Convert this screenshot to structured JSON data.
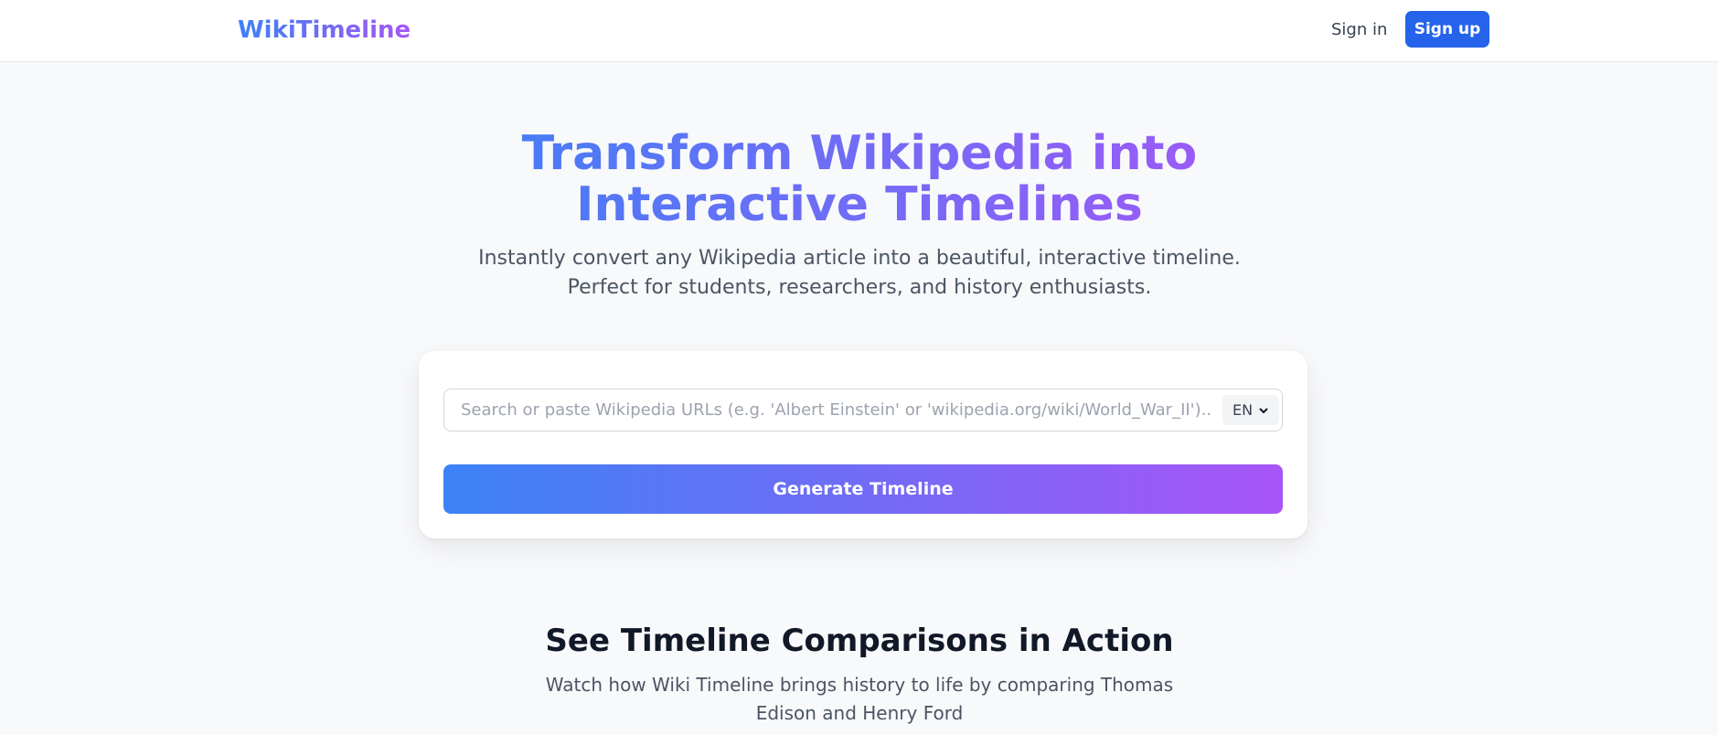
{
  "nav": {
    "brand": "WikiTimeline",
    "signin_label": "Sign in",
    "signup_label": "Sign up"
  },
  "hero": {
    "title": "Transform Wikipedia into Interactive Timelines",
    "subtitle": "Instantly convert any Wikipedia article into a beautiful, interactive timeline. Perfect for students, researchers, and history enthusiasts."
  },
  "search": {
    "placeholder": "Search or paste Wikipedia URLs (e.g. 'Albert Einstein' or 'wikipedia.org/wiki/World_War_II')...",
    "value": "",
    "language": "EN",
    "generate_label": "Generate Timeline"
  },
  "comparisons": {
    "title": "See Timeline Comparisons in Action",
    "subtitle": "Watch how Wiki Timeline brings history to life by comparing Thomas Edison and Henry Ford"
  },
  "colors": {
    "gradient_start": "#3b82f6",
    "gradient_end": "#a855f7",
    "primary_button": "#2563eb",
    "background": "#f8f9fb"
  },
  "icons": {
    "language_dropdown": "chevron-down-icon"
  }
}
